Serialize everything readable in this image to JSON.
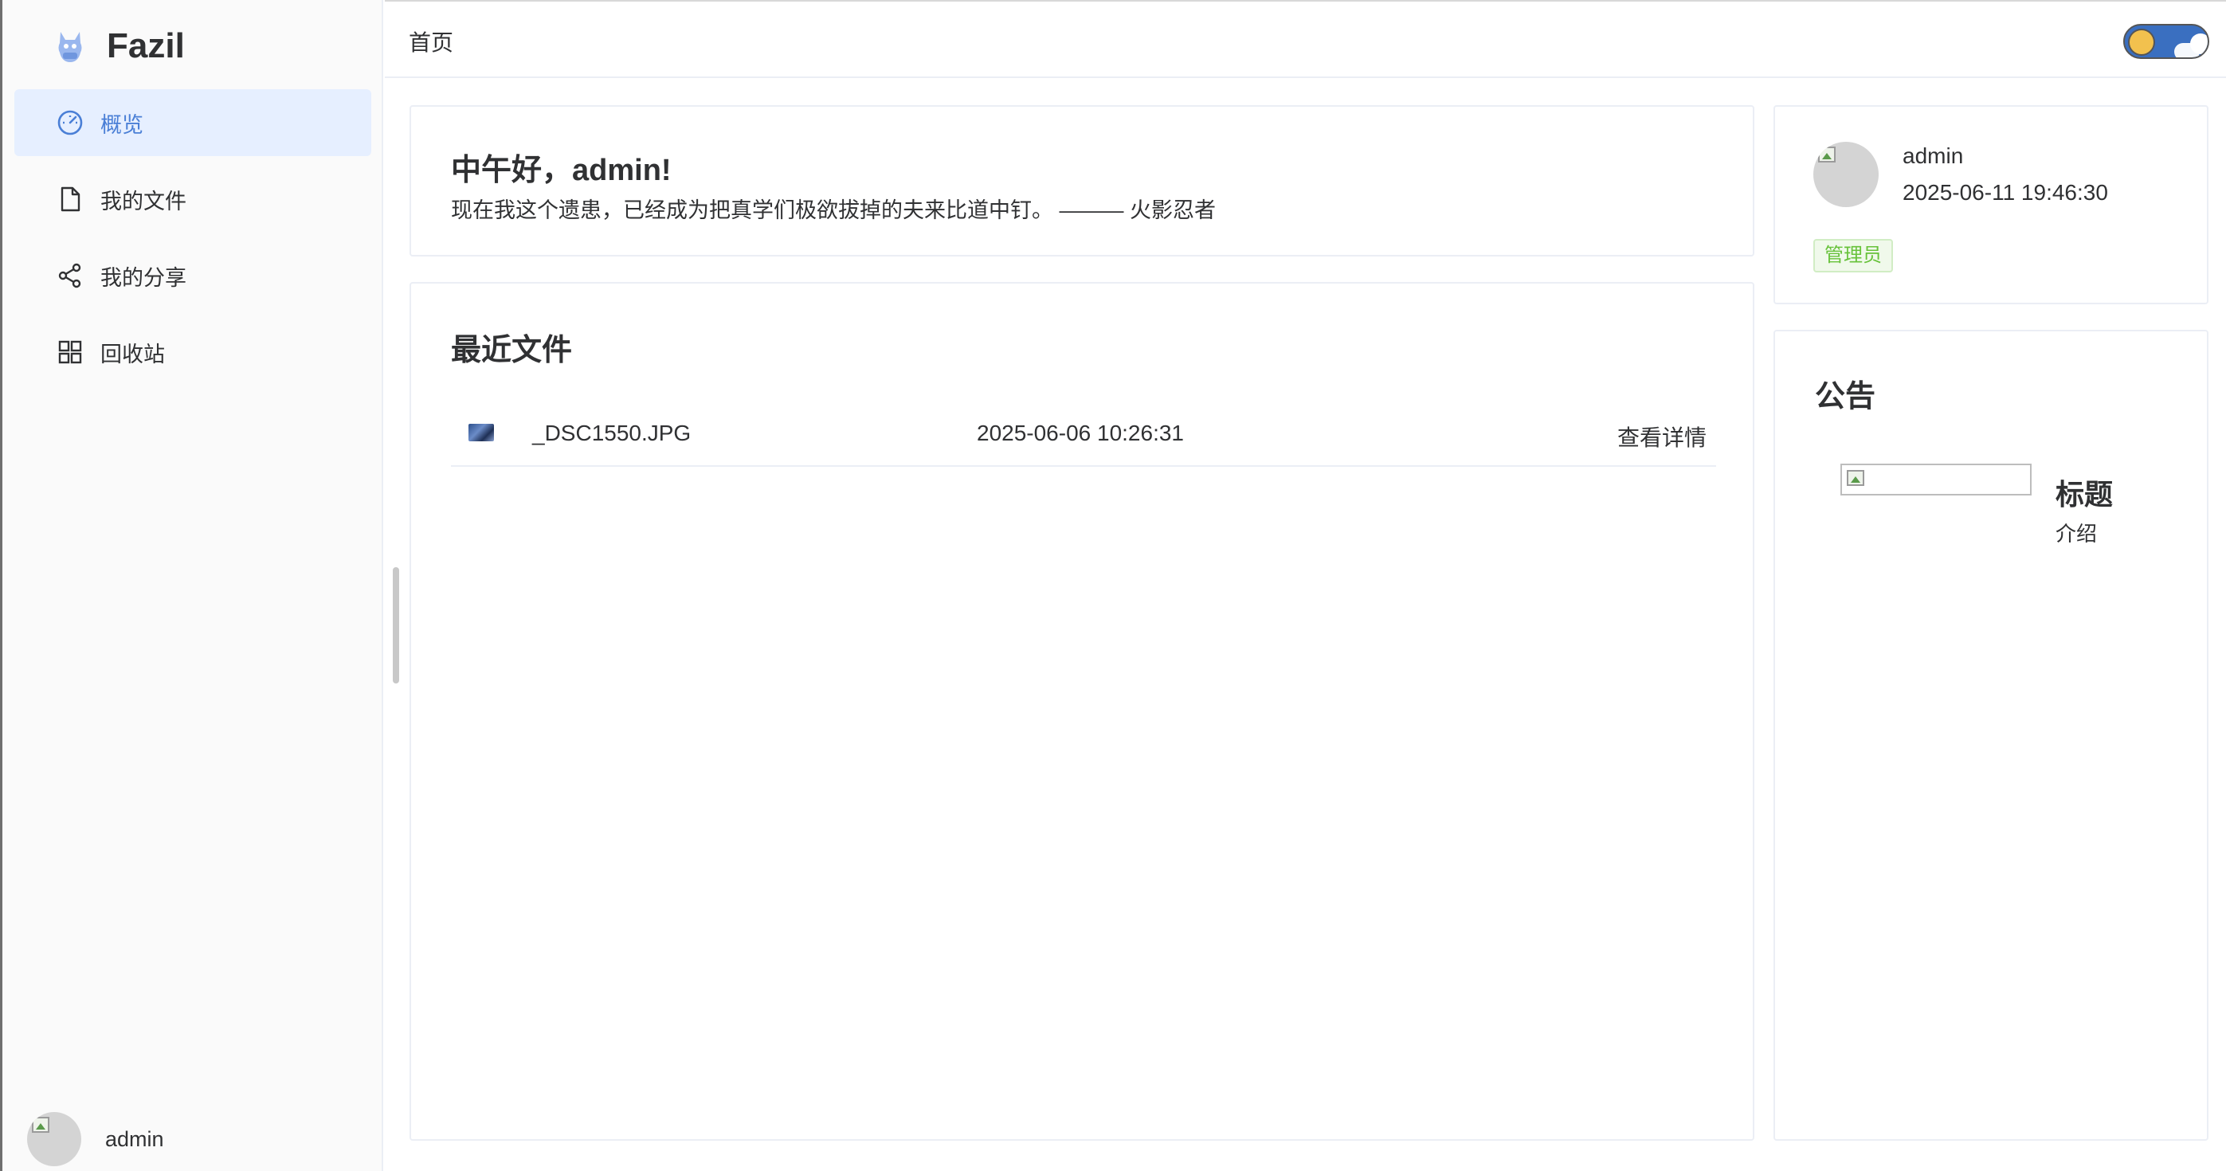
{
  "app": {
    "name": "Fazil"
  },
  "sidebar": {
    "items": [
      {
        "label": "概览",
        "icon": "dashboard-icon",
        "active": true
      },
      {
        "label": "我的文件",
        "icon": "file-icon",
        "active": false
      },
      {
        "label": "我的分享",
        "icon": "share-icon",
        "active": false
      },
      {
        "label": "回收站",
        "icon": "grid-icon",
        "active": false
      }
    ],
    "user": {
      "name": "admin"
    }
  },
  "header": {
    "breadcrumb": "首页"
  },
  "welcome": {
    "title": "中午好，admin!",
    "quote": "现在我这个遗患，已经成为把真学们极欲拔掉的夫来比道中钉。 ——— 火影忍者"
  },
  "recent": {
    "title": "最近文件",
    "files": [
      {
        "name": "_DSC1550.JPG",
        "date": "2025-06-06 10:26:31",
        "action": "查看详情"
      }
    ]
  },
  "profile": {
    "name": "admin",
    "time": "2025-06-11 19:46:30",
    "role": "管理员"
  },
  "notice": {
    "title": "公告",
    "items": [
      {
        "title": "标题",
        "desc": "介绍"
      }
    ]
  },
  "colors": {
    "accent": "#4a7fd6",
    "active_bg": "#e6efff",
    "role_tag": "#67c23a"
  }
}
